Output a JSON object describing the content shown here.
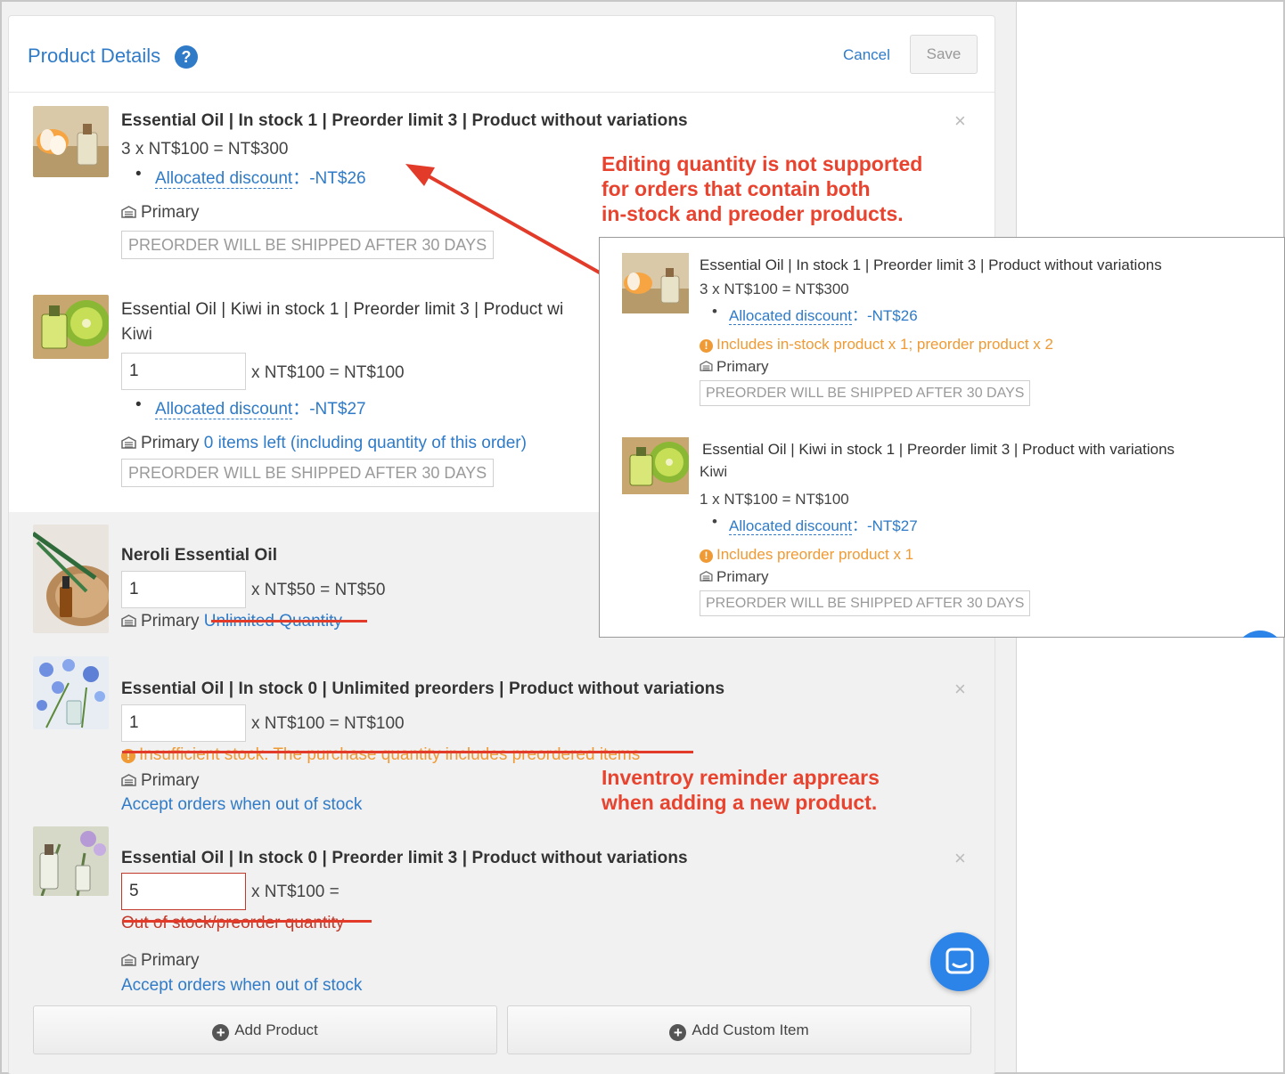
{
  "header": {
    "title": "Product Details",
    "help_glyph": "?",
    "cancel_label": "Cancel",
    "save_label": "Save"
  },
  "items": [
    {
      "title": "Essential Oil | In stock 1 | Preorder limit 3 | Product without variations",
      "calc": "3 x NT$100 = NT$300",
      "discount_label": "Allocated discount",
      "discount_value": "：-NT$26",
      "warehouse": "Primary",
      "tag": "PREORDER WILL BE SHIPPED AFTER 30 DAYS"
    },
    {
      "title": "Essential Oil | Kiwi in stock 1 | Preorder limit 3 | Product wi",
      "variant": "Kiwi",
      "qty": "1",
      "price": "x NT$100 = NT$100",
      "discount_label": "Allocated discount",
      "discount_value": "：-NT$27",
      "warehouse": "Primary",
      "stock_note": "0 items left (including quantity of this order)",
      "tag": "PREORDER WILL BE SHIPPED AFTER 30 DAYS"
    },
    {
      "title": "Neroli Essential Oil",
      "qty": "1",
      "price": "x NT$50 = NT$50",
      "warehouse": "Primary",
      "stock_note": "Unlimited Quantity"
    },
    {
      "title": "Essential Oil | In stock 0 | Unlimited preorders | Product without variations",
      "qty": "1",
      "price": "x NT$100 = NT$100",
      "warning": "Insufficient stock. The purchase quantity includes preordered items",
      "warehouse": "Primary",
      "accept_note": "Accept orders when out of stock"
    },
    {
      "title": "Essential Oil | In stock 0 | Preorder limit 3 | Product without variations",
      "qty": "5",
      "price": "x NT$100 =",
      "error": "Out of stock/preorder quantity",
      "warehouse": "Primary",
      "accept_note": "Accept orders when out of stock"
    }
  ],
  "remove_glyph": "×",
  "warn_glyph": "!",
  "plus_glyph": "+",
  "footer": {
    "add_product_label": "Add Product",
    "add_custom_label": "Add Custom Item"
  },
  "annotations": {
    "top_lines": [
      "Editing quantity is not supported",
      "for orders that contain both",
      "in-stock and preoder products."
    ],
    "bottom_lines": [
      "Inventroy reminder apprears",
      "when adding a new product."
    ]
  },
  "popup": {
    "items": [
      {
        "title": "Essential Oil | In stock 1 | Preorder limit 3 | Product without variations",
        "calc": "3 x NT$100 = NT$300",
        "discount_label": "Allocated discount",
        "discount_value": "：-NT$26",
        "warning": "Includes in-stock product x 1; preorder product x 2",
        "warehouse": "Primary",
        "tag": "PREORDER WILL BE SHIPPED AFTER 30 DAYS"
      },
      {
        "title": "Essential Oil | Kiwi in stock 1 | Preorder limit 3 | Product with variations",
        "variant": "Kiwi",
        "calc": "1 x NT$100 = NT$100",
        "discount_label": "Allocated discount",
        "discount_value": "：-NT$27",
        "warning": "Includes preorder product x 1",
        "warehouse": "Primary",
        "tag": "PREORDER WILL BE SHIPPED AFTER 30 DAYS"
      }
    ]
  },
  "colors": {
    "accent": "#2f7bc8",
    "warning": "#ef9a34",
    "error": "#c0392b",
    "annotation": "#e8432f",
    "chat_button": "#2d84e8"
  }
}
